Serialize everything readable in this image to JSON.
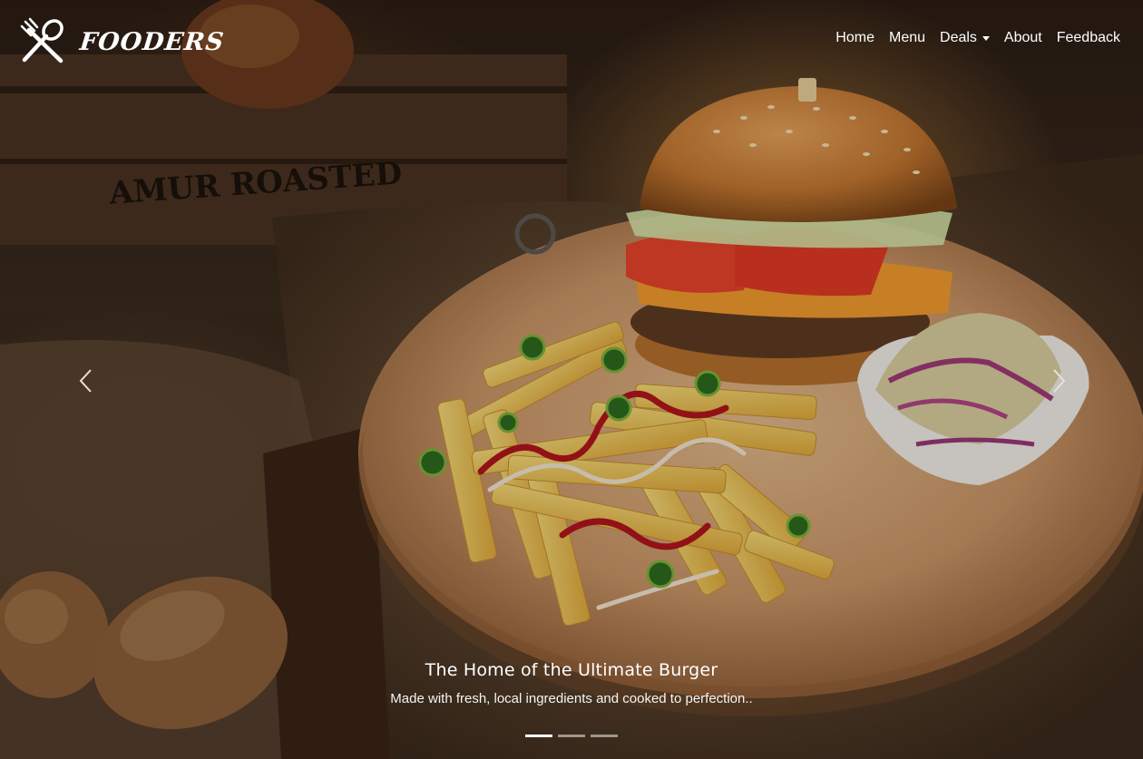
{
  "brand": {
    "name": "FOODERS",
    "logo_icon": "fork-spoon-cross-icon"
  },
  "nav": {
    "items": [
      {
        "label": "Home"
      },
      {
        "label": "Menu"
      },
      {
        "label": "Deals",
        "dropdown": true
      },
      {
        "label": "About"
      },
      {
        "label": "Feedback"
      }
    ]
  },
  "carousel": {
    "prev_icon": "chevron-left-icon",
    "next_icon": "chevron-right-icon",
    "caption_title": "The Home of the Ultimate Burger",
    "caption_text": "Made with fresh, local ingredients and cooked to perfection..",
    "slide_count": 3,
    "active_index": 0
  },
  "scene": {
    "crate_text": "AMUR ROASTED"
  }
}
